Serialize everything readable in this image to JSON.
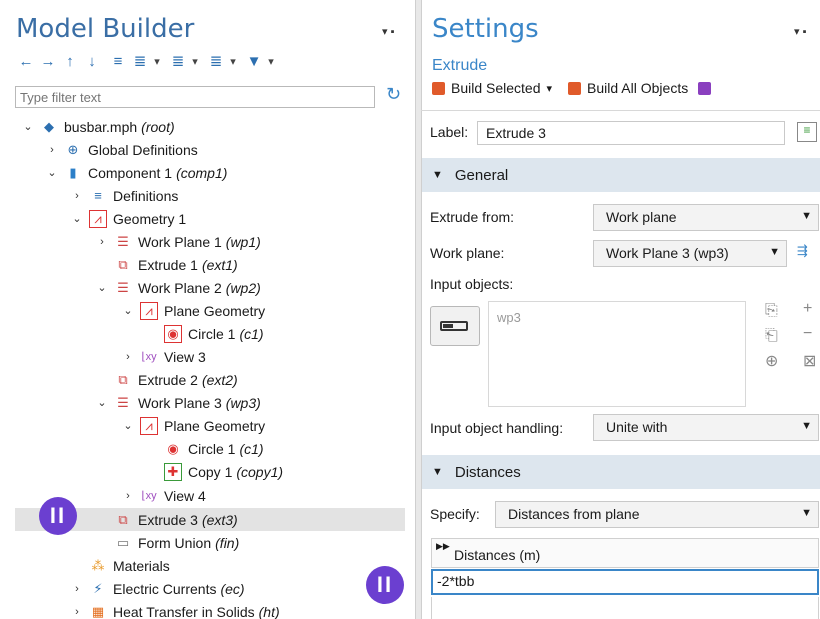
{
  "left": {
    "title": "Model Builder",
    "toolbar": [
      "←",
      "→",
      "↑",
      "↓",
      "≡",
      "⇊",
      "▾",
      "≣",
      "▾",
      "≣",
      "▾",
      "▼",
      "▾"
    ],
    "filter_placeholder": "Type filter text",
    "tree": [
      {
        "label": "busbar.mph",
        "tag": "(root)"
      },
      {
        "label": "Global Definitions",
        "tag": ""
      },
      {
        "label": "Component 1",
        "tag": "(comp1)"
      },
      {
        "label": "Definitions",
        "tag": ""
      },
      {
        "label": "Geometry 1",
        "tag": ""
      },
      {
        "label": "Work Plane 1",
        "tag": "(wp1)"
      },
      {
        "label": "Extrude 1",
        "tag": "(ext1)"
      },
      {
        "label": "Work Plane 2",
        "tag": "(wp2)"
      },
      {
        "label": "Plane Geometry",
        "tag": ""
      },
      {
        "label": "Circle 1",
        "tag": "(c1)"
      },
      {
        "label": "View 3",
        "tag": ""
      },
      {
        "label": "Extrude 2",
        "tag": "(ext2)"
      },
      {
        "label": "Work Plane 3",
        "tag": "(wp3)"
      },
      {
        "label": "Plane Geometry",
        "tag": ""
      },
      {
        "label": "Circle 1",
        "tag": "(c1)"
      },
      {
        "label": "Copy 1",
        "tag": "(copy1)"
      },
      {
        "label": "View 4",
        "tag": ""
      },
      {
        "label": "Extrude 3",
        "tag": "(ext3)"
      },
      {
        "label": "Form Union",
        "tag": "(fin)"
      },
      {
        "label": "Materials",
        "tag": ""
      },
      {
        "label": "Electric Currents",
        "tag": "(ec)"
      },
      {
        "label": "Heat Transfer in Solids",
        "tag": "(ht)"
      }
    ],
    "badge_text": "II"
  },
  "right": {
    "title": "Settings",
    "subtitle": "Extrude",
    "build_selected": "Build Selected",
    "build_all": "Build All Objects",
    "label_caption": "Label:",
    "label_value": "Extrude 3",
    "general": "General",
    "extrude_from_label": "Extrude from:",
    "extrude_from_value": "Work plane",
    "work_plane_label": "Work plane:",
    "work_plane_value": "Work Plane 3 (wp3)",
    "input_objects_label": "Input objects:",
    "input_objects_value": "wp3",
    "handling_label": "Input object handling:",
    "handling_value": "Unite with",
    "distances": "Distances",
    "specify_label": "Specify:",
    "specify_value": "Distances from plane",
    "table_header": "Distances (m)",
    "table_value": "-2*tbb"
  },
  "colors": {
    "accent": "#3a86c8",
    "badge": "#6b3fd0",
    "selected": "#e3e3e3",
    "section": "#dde6ee"
  }
}
